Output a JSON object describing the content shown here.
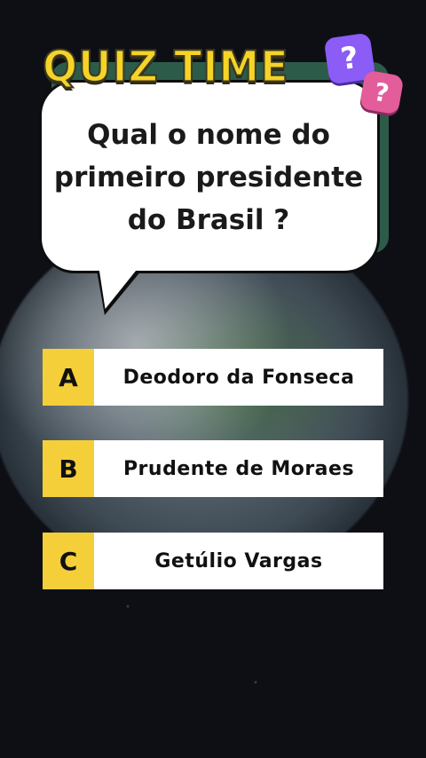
{
  "header": {
    "title": "QUIZ TIME"
  },
  "decor": {
    "badge_mark": "?"
  },
  "question": {
    "text": "Qual o nome do primeiro presidente do Brasil ?"
  },
  "options": [
    {
      "letter": "A",
      "text": "Deodoro da Fonseca"
    },
    {
      "letter": "B",
      "text": "Prudente de Moraes"
    },
    {
      "letter": "C",
      "text": "Getúlio Vargas"
    }
  ],
  "colors": {
    "title": "#f5d327",
    "option_letter_bg": "#f5cf3a",
    "bubble_bg": "#ffffff",
    "bubble_shadow": "#2c5b4a"
  },
  "icons": [
    "question-mark-icon"
  ]
}
